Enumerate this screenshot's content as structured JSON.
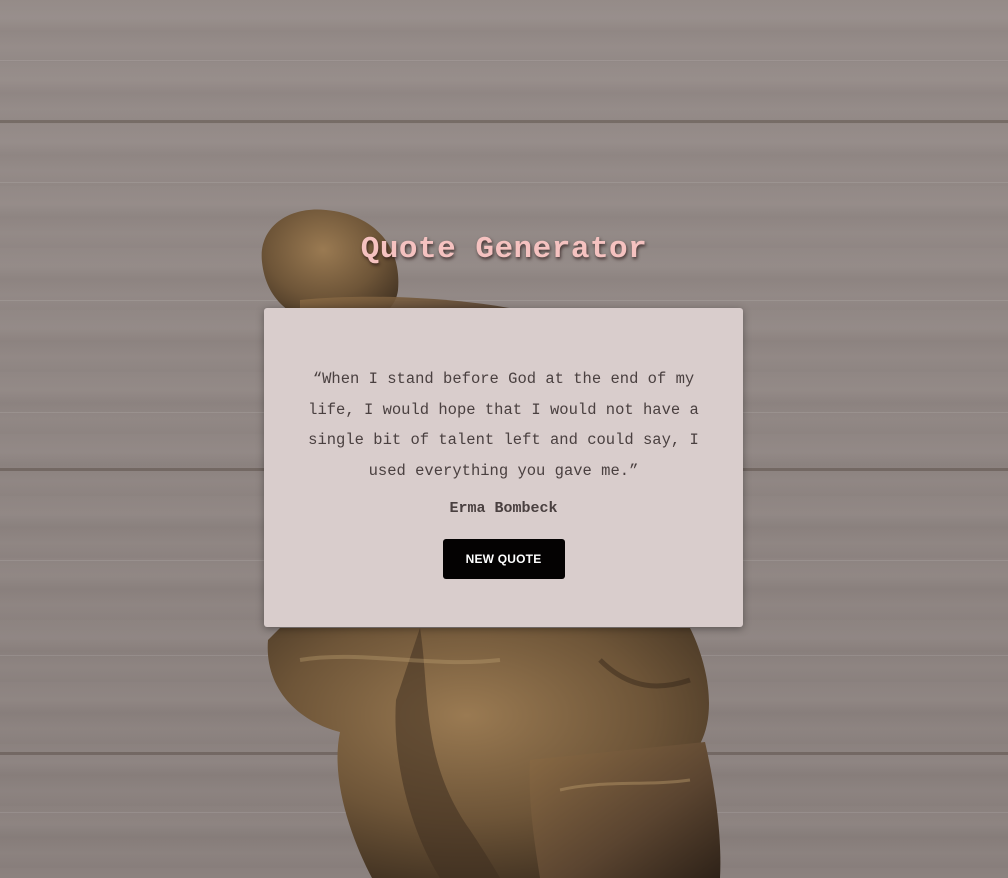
{
  "page": {
    "title": "Quote Generator"
  },
  "quote": {
    "text": "“When I stand before God at the end of my life, I would hope that I would not have a single bit of talent left and could say, I used everything you gave me.”",
    "author": "Erma Bombeck"
  },
  "actions": {
    "new_quote_label": "NEW QUOTE"
  },
  "theme": {
    "title_color": "#f5c2c0",
    "card_background": "#d9cdcc",
    "button_background": "#040202",
    "text_color": "#4a4040"
  }
}
